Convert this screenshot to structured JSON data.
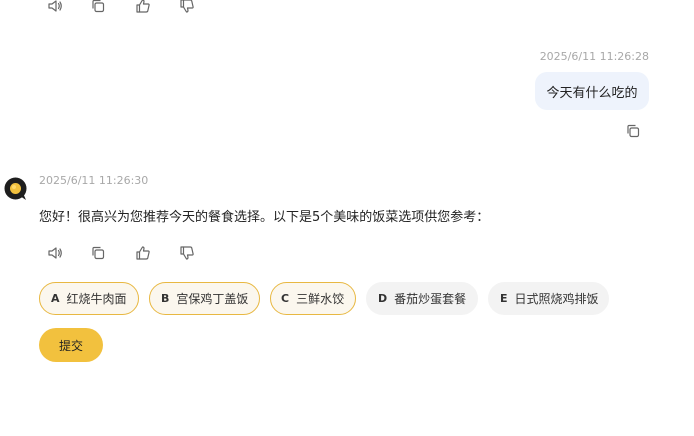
{
  "top_actions": {
    "icons": [
      "speaker-icon",
      "copy-icon",
      "thumbs-up-icon",
      "thumbs-down-icon"
    ]
  },
  "user_message": {
    "timestamp": "2025/6/11 11:26:28",
    "text": "今天有什么吃的"
  },
  "assistant_message": {
    "timestamp": "2025/6/11 11:26:30",
    "text": "您好！很高兴为您推荐今天的餐食选择。以下是5个美味的饭菜选项供您参考："
  },
  "options": [
    {
      "letter": "A",
      "label": "红烧牛肉面",
      "selected": true
    },
    {
      "letter": "B",
      "label": "宫保鸡丁盖饭",
      "selected": true
    },
    {
      "letter": "C",
      "label": "三鲜水饺",
      "selected": true
    },
    {
      "letter": "D",
      "label": "番茄炒蛋套餐",
      "selected": false
    },
    {
      "letter": "E",
      "label": "日式照烧鸡排饭",
      "selected": false
    }
  ],
  "submit_label": "提交",
  "colors": {
    "accent": "#f2c13e",
    "selected_border": "#e8b842",
    "user_bubble": "#eef3fc",
    "timestamp": "#a8a8a8"
  }
}
